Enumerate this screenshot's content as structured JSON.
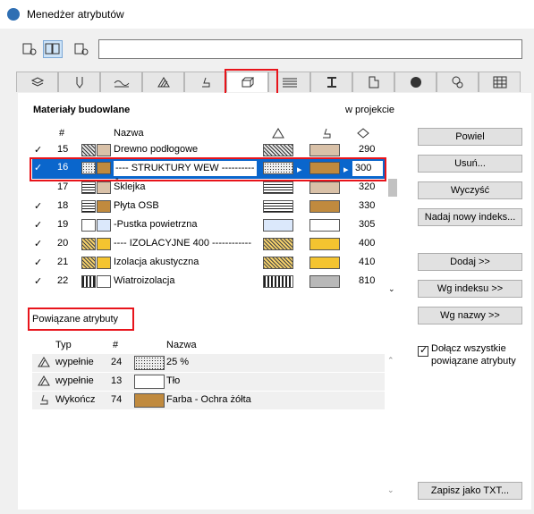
{
  "window": {
    "title": "Menedżer atrybutów"
  },
  "search": {
    "value": ""
  },
  "panel": {
    "title": "Materiały budowlane",
    "projection_label": "w projekcie"
  },
  "columns": {
    "num": "#",
    "name": "Nazwa"
  },
  "rows": [
    {
      "checked": true,
      "num": "15",
      "name": "Drewno podłogowe",
      "index": "290"
    },
    {
      "checked": true,
      "num": "16",
      "name": "---- STRUKTURY WEW -----------",
      "index": "300"
    },
    {
      "checked": false,
      "num": "17",
      "name": "Sklejka",
      "index": "320"
    },
    {
      "checked": true,
      "num": "18",
      "name": "Płyta OSB",
      "index": "330"
    },
    {
      "checked": true,
      "num": "19",
      "name": "-Pustka powietrzna",
      "index": "305"
    },
    {
      "checked": true,
      "num": "20",
      "name": "---- IZOLACYJNE 400 ------------",
      "index": "400"
    },
    {
      "checked": true,
      "num": "21",
      "name": "Izolacja akustyczna",
      "index": "410"
    },
    {
      "checked": true,
      "num": "22",
      "name": "Wiatroizolacja",
      "index": "810"
    }
  ],
  "buttons": {
    "duplicate": "Powiel",
    "delete": "Usuń...",
    "clear": "Wyczyść",
    "new_index": "Nadaj nowy indeks...",
    "add": "Dodaj >>",
    "by_index": "Wg indeksu >>",
    "by_name": "Wg nazwy >>",
    "save_txt": "Zapisz jako TXT..."
  },
  "related": {
    "title": "Powiązane atrybuty",
    "headers": {
      "type": "Typ",
      "num": "#",
      "name": "Nazwa"
    },
    "rows": [
      {
        "type": "wypełnie",
        "num": "24",
        "name": "25 %"
      },
      {
        "type": "wypełnie",
        "num": "13",
        "name": "Tło"
      },
      {
        "type": "Wykończ",
        "num": "74",
        "name": "Farba - Ochra żółta"
      }
    ],
    "include_label": "Dołącz wszystkie powiązane atrybuty",
    "include_checked": true
  },
  "colors": {
    "selection": "#0a66cc",
    "highlight": "#e8141b",
    "ochre": "#c08a3e"
  }
}
